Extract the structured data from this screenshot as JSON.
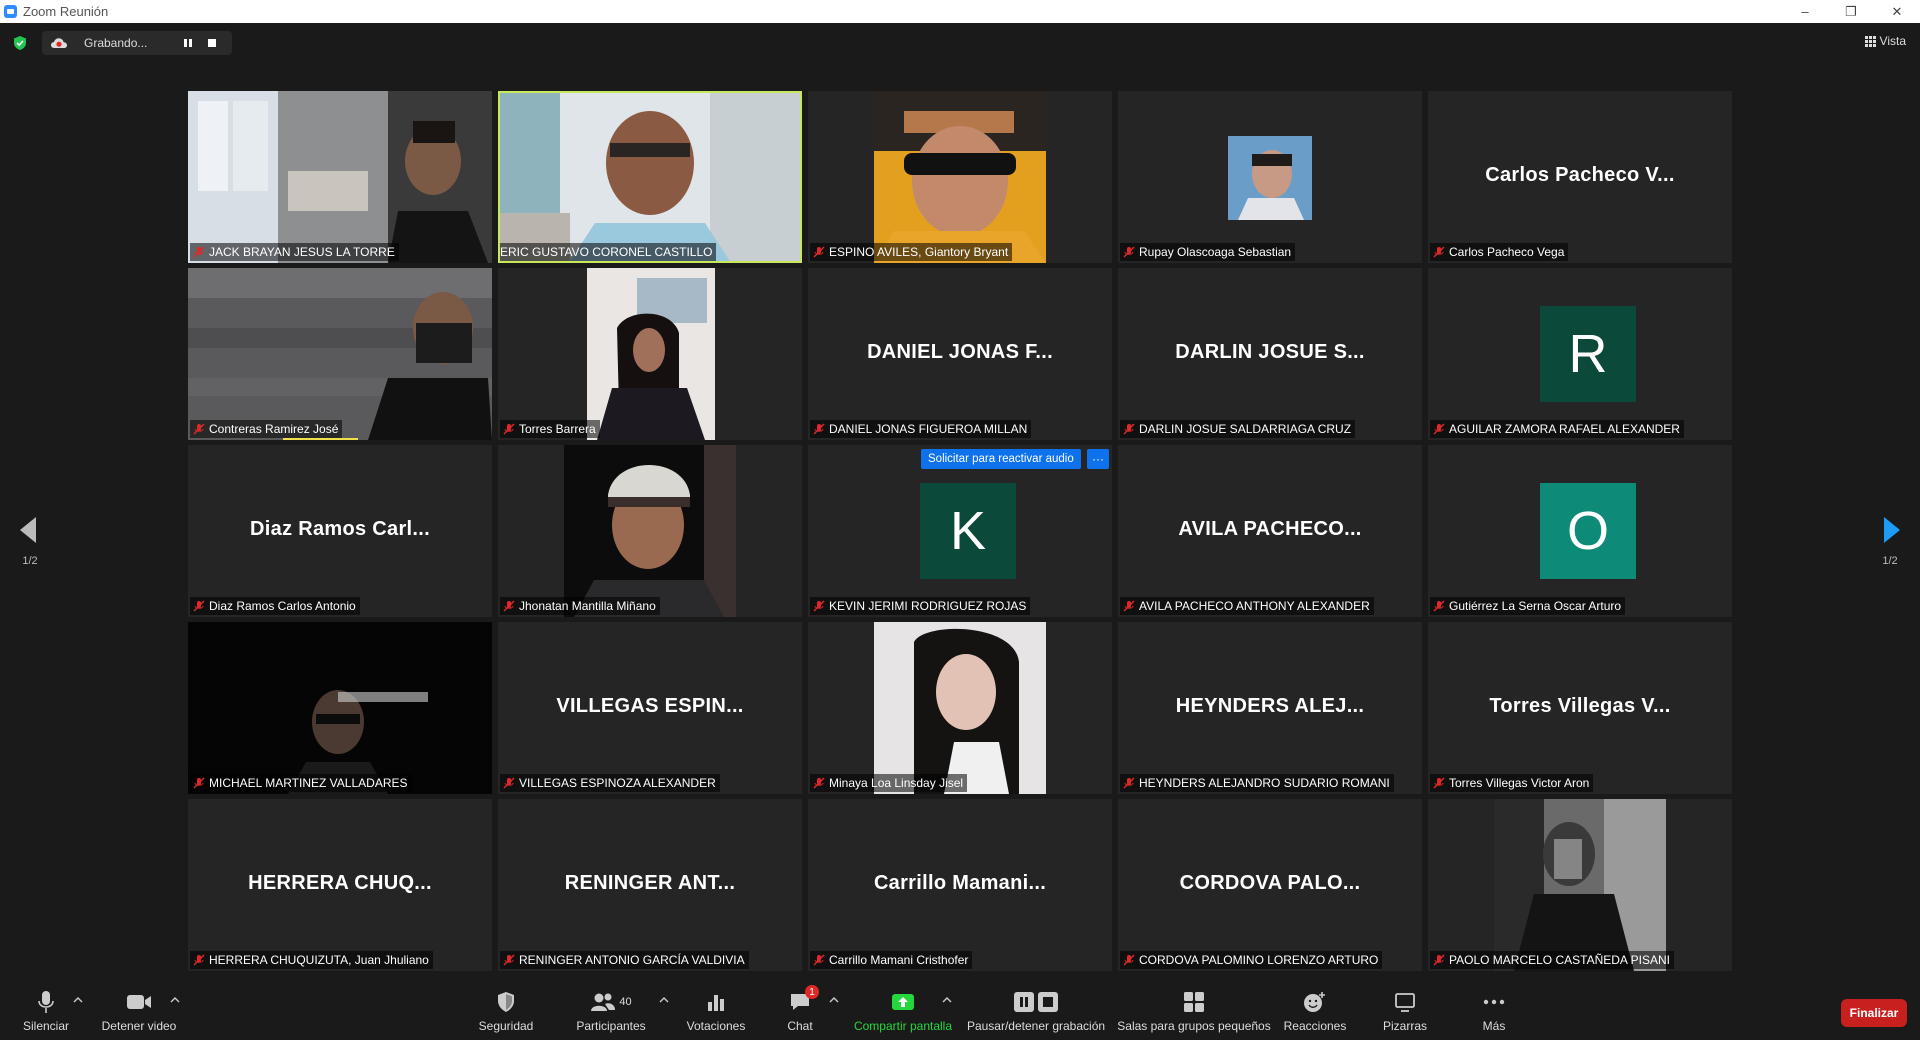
{
  "window": {
    "title": "Zoom Reunión"
  },
  "topbar": {
    "recording_label": "Grabando...",
    "view_label": "Vista"
  },
  "pager": {
    "left_label": "1/2",
    "right_label": "1/2"
  },
  "participants": [
    {
      "id": "p1",
      "display": "video",
      "name": "JACK BRAYAN JESUS LA TORRE",
      "big": ""
    },
    {
      "id": "p2",
      "display": "video",
      "name": "ERIC GUSTAVO CORONEL CASTILLO",
      "big": "",
      "active": true
    },
    {
      "id": "p3",
      "display": "video",
      "name": "ESPINO AVILES, Giantory Bryant",
      "big": ""
    },
    {
      "id": "p4",
      "display": "photo",
      "name": "Rupay Olascoaga Sebastian",
      "big": ""
    },
    {
      "id": "p5",
      "display": "name",
      "name": "Carlos Pacheco Vega",
      "big": "Carlos Pacheco V..."
    },
    {
      "id": "p6",
      "display": "video",
      "name": "Contreras Ramirez José",
      "big": ""
    },
    {
      "id": "p7",
      "display": "video",
      "name": "Torres Barrera",
      "big": ""
    },
    {
      "id": "p8",
      "display": "name",
      "name": "DANIEL JONAS FIGUEROA MILLAN",
      "big": "DANIEL JONAS F..."
    },
    {
      "id": "p9",
      "display": "name",
      "name": "DARLIN JOSUE SALDARRIAGA CRUZ",
      "big": "DARLIN JOSUE S..."
    },
    {
      "id": "p10",
      "display": "avatar",
      "name": "AGUILAR ZAMORA RAFAEL ALEXANDER",
      "big": "R",
      "avatar_color": "#0b4a3a"
    },
    {
      "id": "p11",
      "display": "name",
      "name": "Diaz Ramos Carlos Antonio",
      "big": "Diaz Ramos Carl..."
    },
    {
      "id": "p12",
      "display": "video",
      "name": "Jhonatan Mantilla Miñano",
      "big": ""
    },
    {
      "id": "p13",
      "display": "avatar",
      "name": "KEVIN JERIMI RODRIGUEZ ROJAS",
      "big": "K",
      "avatar_color": "#0b4a3a"
    },
    {
      "id": "p14",
      "display": "name",
      "name": "AVILA PACHECO ANTHONY ALEXANDER",
      "big": "AVILA PACHECO..."
    },
    {
      "id": "p15",
      "display": "avatar",
      "name": "Gutiérrez La Serna Oscar Arturo",
      "big": "O",
      "avatar_color": "#0d8a78"
    },
    {
      "id": "p16",
      "display": "video",
      "name": "MICHAEL MARTINEZ VALLADARES",
      "big": ""
    },
    {
      "id": "p17",
      "display": "name",
      "name": "VILLEGAS ESPINOZA ALEXANDER",
      "big": "VILLEGAS ESPIN..."
    },
    {
      "id": "p18",
      "display": "video",
      "name": "Minaya Loa Linsday Jisel",
      "big": ""
    },
    {
      "id": "p19",
      "display": "name",
      "name": "HEYNDERS ALEJANDRO SUDARIO ROMANI",
      "big": "HEYNDERS ALEJ..."
    },
    {
      "id": "p20",
      "display": "name",
      "name": "Torres Villegas Victor Aron",
      "big": "Torres Villegas V..."
    },
    {
      "id": "p21",
      "display": "name",
      "name": "HERRERA CHUQUIZUTA, Juan Jhuliano",
      "big": "HERRERA CHUQ..."
    },
    {
      "id": "p22",
      "display": "name",
      "name": "RENINGER ANTONIO GARCÍA VALDIVIA",
      "big": "RENINGER ANT..."
    },
    {
      "id": "p23",
      "display": "name",
      "name": "Carrillo Mamani Cristhofer",
      "big": "Carrillo Mamani..."
    },
    {
      "id": "p24",
      "display": "name",
      "name": "CORDOVA PALOMINO LORENZO ARTURO",
      "big": "CORDOVA PALO..."
    },
    {
      "id": "p25",
      "display": "video",
      "name": "PAOLO MARCELO CASTAÑEDA PISANI",
      "big": ""
    }
  ],
  "unmute_request": {
    "label": "Solicitar para reactivar audio",
    "more": "···"
  },
  "toolbar": {
    "mute": "Silenciar",
    "video": "Detener video",
    "security": "Seguridad",
    "participants": "Participantes",
    "participants_count": "40",
    "polls": "Votaciones",
    "chat": "Chat",
    "chat_badge": "1",
    "share": "Compartir pantalla",
    "record": "Pausar/detener grabación",
    "breakout": "Salas para grupos pequeños",
    "reactions": "Reacciones",
    "whiteboards": "Pizarras",
    "more": "Más",
    "end": "Finalizar"
  },
  "colors": {
    "background": "#1a1a1a",
    "tile": "#252525",
    "active_speaker": "#c6e85a",
    "share_green": "#26d63d",
    "end_red": "#c8201e",
    "accent_blue": "#0e72ed"
  }
}
